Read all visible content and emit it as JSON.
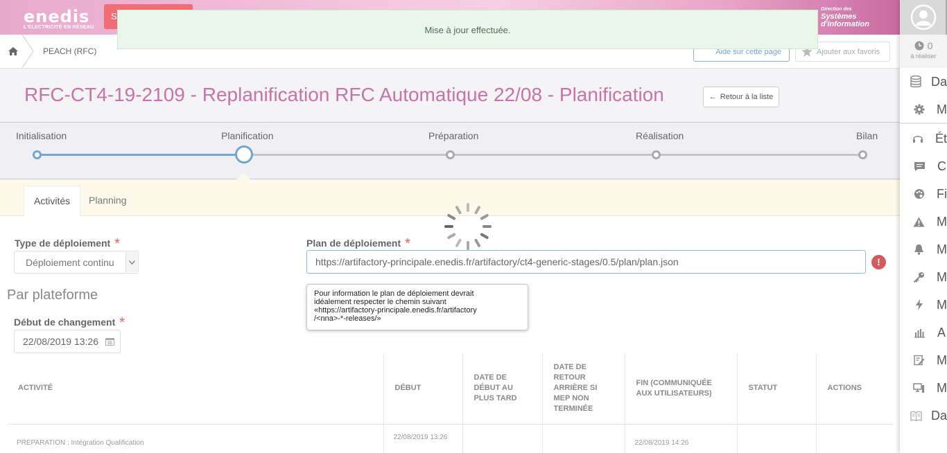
{
  "header": {
    "brand": "enedis",
    "tagline": "L'ÉLECTRICITÉ EN RÉSEAU",
    "red_button": "S",
    "dsi_line1": "Direction des",
    "dsi_line2": "Systèmes",
    "dsi_line3": "d'Information"
  },
  "toast": {
    "message": "Mise à jour effectuée."
  },
  "breadcrumb": {
    "item": "PEACH (RFC)"
  },
  "toolbar": {
    "help_label": "Aide sur cette page",
    "fav_label": "Ajouter aux favoris"
  },
  "page": {
    "title": "RFC-CT4-19-2109 - Replanification RFC Automatique 22/08 - Planification",
    "back_label": "Retour à la liste"
  },
  "stepper": {
    "steps": [
      "Initialisation",
      "Planification",
      "Préparation",
      "Réalisation",
      "Bilan"
    ],
    "current_index": 1
  },
  "tabs": [
    "Activités",
    "Planning"
  ],
  "form": {
    "type_label": "Type de déploiement",
    "type_value": "Déploiement continu",
    "plan_label": "Plan de déploiement",
    "plan_value": "https://artifactory-principale.enedis.fr/artifactory/ct4-generic-stages/0.5/plan/plan.json",
    "warning_symbol": "!",
    "tooltip_line1": "Pour information le plan de déploiement devrait",
    "tooltip_line2": "idéalement respecter le chemin suivant",
    "tooltip_line3": "«https://artifactory-principale.enedis.fr/artifactory",
    "tooltip_line4": "/<nna>-*-releases/»",
    "section_title": "Par plateforme",
    "start_label": "Début de changement",
    "start_value": "22/08/2019 13:26",
    "required_mark": "*"
  },
  "table": {
    "headers": [
      "ACTIVITÉ",
      "DÉBUT",
      "DATE DE DÉBUT AU PLUS TARD",
      "DATE DE RETOUR ARRIÈRE SI MEP NON TERMINÉE",
      "FIN (COMMUNIQUÉE AUX UTILISATEURS)",
      "STATUT",
      "ACTIONS"
    ],
    "rows": [
      [
        "PREPARATION : Intégration Qualification",
        "22/08/2019 13:26",
        "",
        "",
        "22/08/2019 14:26",
        "",
        ""
      ]
    ]
  },
  "sidebar": {
    "todo_count": "0",
    "todo_label": "à réaliser",
    "items": [
      {
        "icon": "database-icon",
        "text": "Da"
      },
      {
        "icon": "gear-icon",
        "text": "M"
      },
      {
        "icon": "headset-icon",
        "text": "Ét"
      },
      {
        "icon": "chat-icon",
        "text": "C"
      },
      {
        "icon": "palette-icon",
        "text": "Fi"
      },
      {
        "icon": "warning-icon",
        "text": "M"
      },
      {
        "icon": "bell-icon",
        "text": "M"
      },
      {
        "icon": "key-icon",
        "text": "M"
      },
      {
        "icon": "bolt-icon",
        "text": "M"
      },
      {
        "icon": "bar-chart-icon",
        "text": "A"
      },
      {
        "icon": "edit-icon",
        "text": "M"
      },
      {
        "icon": "monitor-icon",
        "text": "M"
      },
      {
        "icon": "book-icon",
        "text": "Da"
      }
    ]
  },
  "colors": {
    "title": "#c673a8",
    "accent_blue": "#6fa6d6",
    "required": "#e85f5f"
  }
}
